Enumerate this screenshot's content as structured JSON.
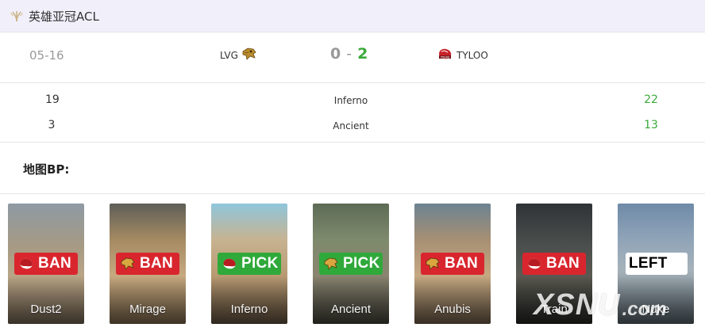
{
  "header": {
    "title": "英雄亚冠ACL",
    "icon": "laurel-icon"
  },
  "match": {
    "date": "05-16",
    "team_a": {
      "name": "LVG",
      "logo": "lvg-logo-icon"
    },
    "team_b": {
      "name": "TYLOO",
      "logo": "tyloo-logo-icon"
    },
    "score_a": "0",
    "separator": "-",
    "score_b": "2"
  },
  "map_results": [
    {
      "score_a": "19",
      "map": "Inferno",
      "score_b": "22"
    },
    {
      "score_a": "3",
      "map": "Ancient",
      "score_b": "13"
    }
  ],
  "bp": {
    "label": "地图BP:",
    "cards": [
      {
        "map": "Dust2",
        "action": "BAN",
        "team": "tyloo"
      },
      {
        "map": "Mirage",
        "action": "BAN",
        "team": "lvg"
      },
      {
        "map": "Inferno",
        "action": "PICK",
        "team": "tyloo"
      },
      {
        "map": "Ancient",
        "action": "PICK",
        "team": "lvg"
      },
      {
        "map": "Anubis",
        "action": "BAN",
        "team": "lvg"
      },
      {
        "map": "Train",
        "action": "BAN",
        "team": "tyloo"
      },
      {
        "map": "Nuke",
        "action": "LEFT",
        "team": ""
      }
    ]
  },
  "watermark": {
    "main": "XSNU",
    "suffix": ".com"
  },
  "colors": {
    "header_bg": "#f1effa",
    "win_green": "#3aaa3a",
    "ban_red": "#d9262e",
    "pick_green": "#2fa93a"
  }
}
